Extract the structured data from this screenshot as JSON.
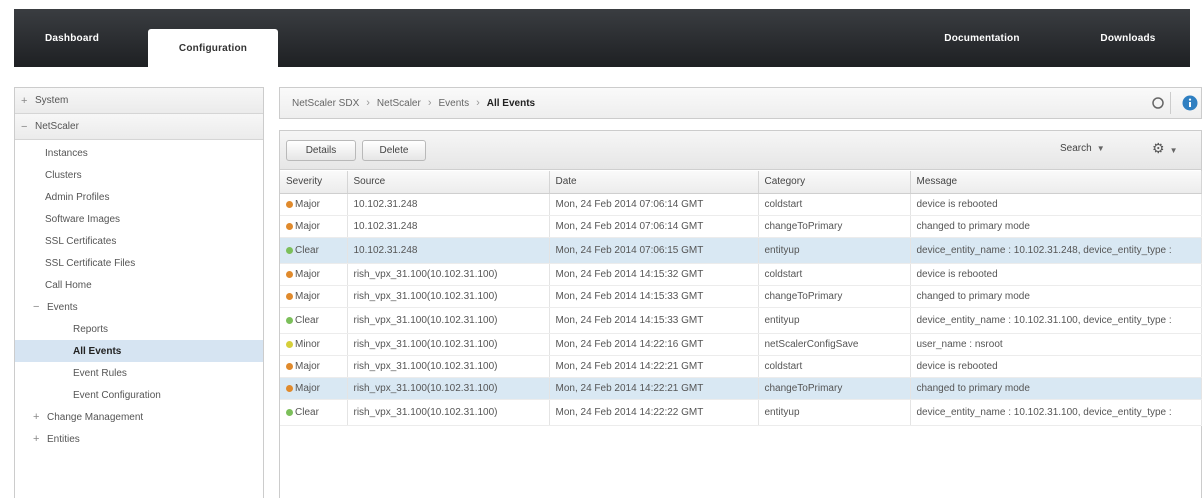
{
  "top_nav": {
    "tabs": [
      {
        "label": "Dashboard"
      },
      {
        "label": "Configuration"
      }
    ],
    "right_links": [
      {
        "label": "Documentation"
      },
      {
        "label": "Downloads"
      }
    ],
    "active_tab": "Configuration"
  },
  "sidebar": {
    "sections": [
      {
        "label": "System",
        "expander": "+"
      },
      {
        "label": "NetScaler",
        "expander": "−"
      }
    ],
    "items": [
      {
        "label": "Instances"
      },
      {
        "label": "Clusters"
      },
      {
        "label": "Admin Profiles"
      },
      {
        "label": "Software Images"
      },
      {
        "label": "SSL Certificates"
      },
      {
        "label": "SSL Certificate Files"
      },
      {
        "label": "Call Home"
      },
      {
        "label": "Events",
        "expander": "−"
      },
      {
        "label": "Reports"
      },
      {
        "label": "All Events",
        "selected": true
      },
      {
        "label": "Event Rules"
      },
      {
        "label": "Event Configuration"
      },
      {
        "label": "Change Management",
        "expander": "+"
      },
      {
        "label": "Entities",
        "expander": "+"
      }
    ]
  },
  "breadcrumb": [
    "NetScaler SDX",
    "NetScaler",
    "Events",
    "All Events"
  ],
  "toolbar": {
    "details_label": "Details",
    "delete_label": "Delete",
    "search_label": "Search"
  },
  "table": {
    "columns": [
      "Severity",
      "Source",
      "Date",
      "Category",
      "Message"
    ],
    "rows": [
      {
        "severity": "Major",
        "source": "10.102.31.248",
        "date": "Mon, 24 Feb 2014 07:06:14 GMT",
        "category": "coldstart",
        "message": "device is rebooted"
      },
      {
        "severity": "Major",
        "source": "10.102.31.248",
        "date": "Mon, 24 Feb 2014 07:06:14 GMT",
        "category": "changeToPrimary",
        "message": "changed to primary mode"
      },
      {
        "severity": "Clear",
        "source": "10.102.31.248",
        "date": "Mon, 24 Feb 2014 07:06:15 GMT",
        "category": "entityup",
        "message": "device_entity_name : 10.102.31.248, device_entity_type :",
        "highlight": true
      },
      {
        "severity": "Major",
        "source": "rish_vpx_31.100(10.102.31.100)",
        "date": "Mon, 24 Feb 2014 14:15:32 GMT",
        "category": "coldstart",
        "message": "device is rebooted"
      },
      {
        "severity": "Major",
        "source": "rish_vpx_31.100(10.102.31.100)",
        "date": "Mon, 24 Feb 2014 14:15:33 GMT",
        "category": "changeToPrimary",
        "message": "changed to primary mode"
      },
      {
        "severity": "Clear",
        "source": "rish_vpx_31.100(10.102.31.100)",
        "date": "Mon, 24 Feb 2014 14:15:33 GMT",
        "category": "entityup",
        "message": "device_entity_name : 10.102.31.100, device_entity_type :"
      },
      {
        "severity": "Minor",
        "source": "rish_vpx_31.100(10.102.31.100)",
        "date": "Mon, 24 Feb 2014 14:22:16 GMT",
        "category": "netScalerConfigSave",
        "message": "user_name : nsroot"
      },
      {
        "severity": "Major",
        "source": "rish_vpx_31.100(10.102.31.100)",
        "date": "Mon, 24 Feb 2014 14:22:21 GMT",
        "category": "coldstart",
        "message": "device is rebooted"
      },
      {
        "severity": "Major",
        "source": "rish_vpx_31.100(10.102.31.100)",
        "date": "Mon, 24 Feb 2014 14:22:21 GMT",
        "category": "changeToPrimary",
        "message": "changed to primary mode",
        "highlight": true
      },
      {
        "severity": "Clear",
        "source": "rish_vpx_31.100(10.102.31.100)",
        "date": "Mon, 24 Feb 2014 14:22:22 GMT",
        "category": "entityup",
        "message": "device_entity_name : 10.102.31.100, device_entity_type :"
      }
    ]
  },
  "severity_colors": {
    "Major": "#e08a2c",
    "Clear": "#7cbf5a",
    "Minor": "#d6cf3a"
  },
  "colors": {
    "topbar": "#2a2c2f",
    "selected_row": "#d9e8f3",
    "help_icon": "#2f7fc1"
  }
}
